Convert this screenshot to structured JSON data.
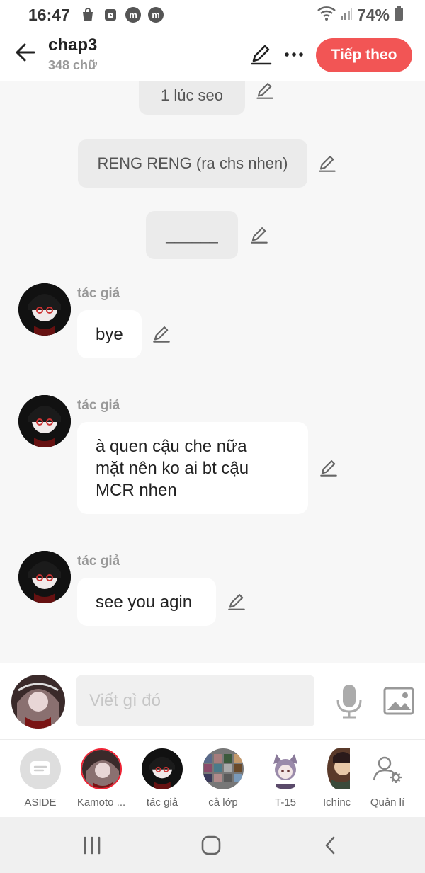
{
  "status_bar": {
    "time": "16:47",
    "battery": "74%"
  },
  "header": {
    "title": "chap3",
    "word_count": "348 chữ",
    "next_button": "Tiếp theo"
  },
  "messages": {
    "narrations": [
      "1 lúc seo",
      "RENG RENG (ra chs nhen)",
      "______"
    ],
    "dialogues": [
      {
        "author": "tác giả",
        "lines": [
          "bye"
        ]
      },
      {
        "author": "tác giả",
        "lines": [
          "à quen cậu che nữa",
          "mặt nên ko ai bt cậu",
          "MCR nhen"
        ]
      },
      {
        "author": "tác giả",
        "lines": [
          "see you agin"
        ]
      }
    ]
  },
  "composer": {
    "placeholder": "Viết gì đó"
  },
  "characters": [
    {
      "name": "ASIDE"
    },
    {
      "name": "Kamoto ..."
    },
    {
      "name": "tác giả"
    },
    {
      "name": "cả lớp"
    },
    {
      "name": "T-15"
    },
    {
      "name": "Ichinc"
    },
    {
      "name": "Quản lí"
    }
  ],
  "colors": {
    "accent": "#f25555",
    "background": "#f7f7f7",
    "narration_bg": "#ebebeb"
  },
  "icons": [
    "back-arrow-icon",
    "pencil-icon",
    "more-icon",
    "mic-icon",
    "image-icon",
    "manage-icon",
    "recents-icon",
    "home-icon",
    "nav-back-icon"
  ]
}
